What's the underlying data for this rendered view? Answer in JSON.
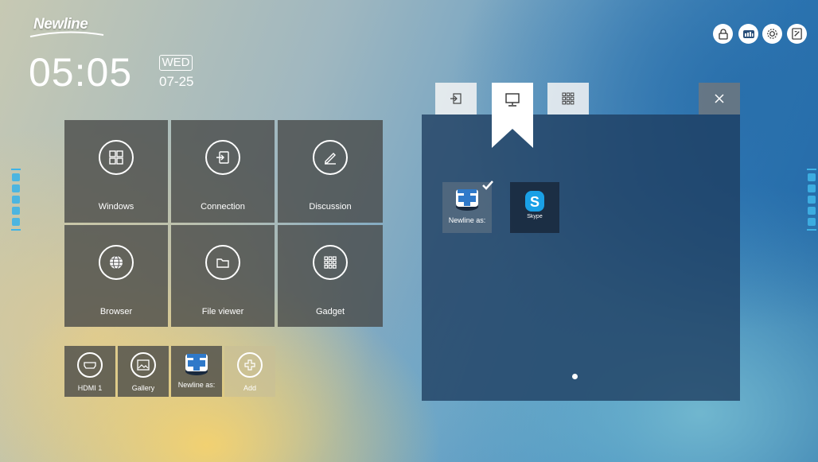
{
  "brand": {
    "name": "Newline"
  },
  "clock": {
    "time": "05:05",
    "day": "WED",
    "date": "07-25"
  },
  "top_buttons": [
    {
      "name": "lock-icon"
    },
    {
      "name": "network-icon"
    },
    {
      "name": "gear-icon"
    },
    {
      "name": "annotate-icon"
    }
  ],
  "tiles": [
    {
      "label": "Windows",
      "icon": "windows-icon"
    },
    {
      "label": "Connection",
      "icon": "connection-icon"
    },
    {
      "label": "Discussion",
      "icon": "pencil-icon"
    },
    {
      "label": "Browser",
      "icon": "globe-icon"
    },
    {
      "label": "File viewer",
      "icon": "folder-icon"
    },
    {
      "label": "Gadget",
      "icon": "grid-icon"
    }
  ],
  "shortcuts": [
    {
      "label": "HDMI 1",
      "icon": "hdmi-icon"
    },
    {
      "label": "Gallery",
      "icon": "gallery-icon"
    },
    {
      "label": "Newline as:",
      "icon": "newline-assistant-icon"
    },
    {
      "label": "Add",
      "icon": "plus-icon"
    }
  ],
  "panel": {
    "tabs": [
      {
        "icon": "input-source-icon"
      },
      {
        "icon": "monitor-icon",
        "active": true
      },
      {
        "icon": "apps-grid-icon"
      }
    ],
    "apps": [
      {
        "label": "Newline as:",
        "selected": true,
        "icon": "newline-assistant-icon"
      },
      {
        "label": "Skype",
        "selected": false,
        "icon": "skype-icon"
      }
    ],
    "page": {
      "current": 1,
      "total": 1
    }
  },
  "colors": {
    "accent": "#3fb3e6",
    "tile_bg": "#464846",
    "panel_bg": "#1e3c5f"
  }
}
